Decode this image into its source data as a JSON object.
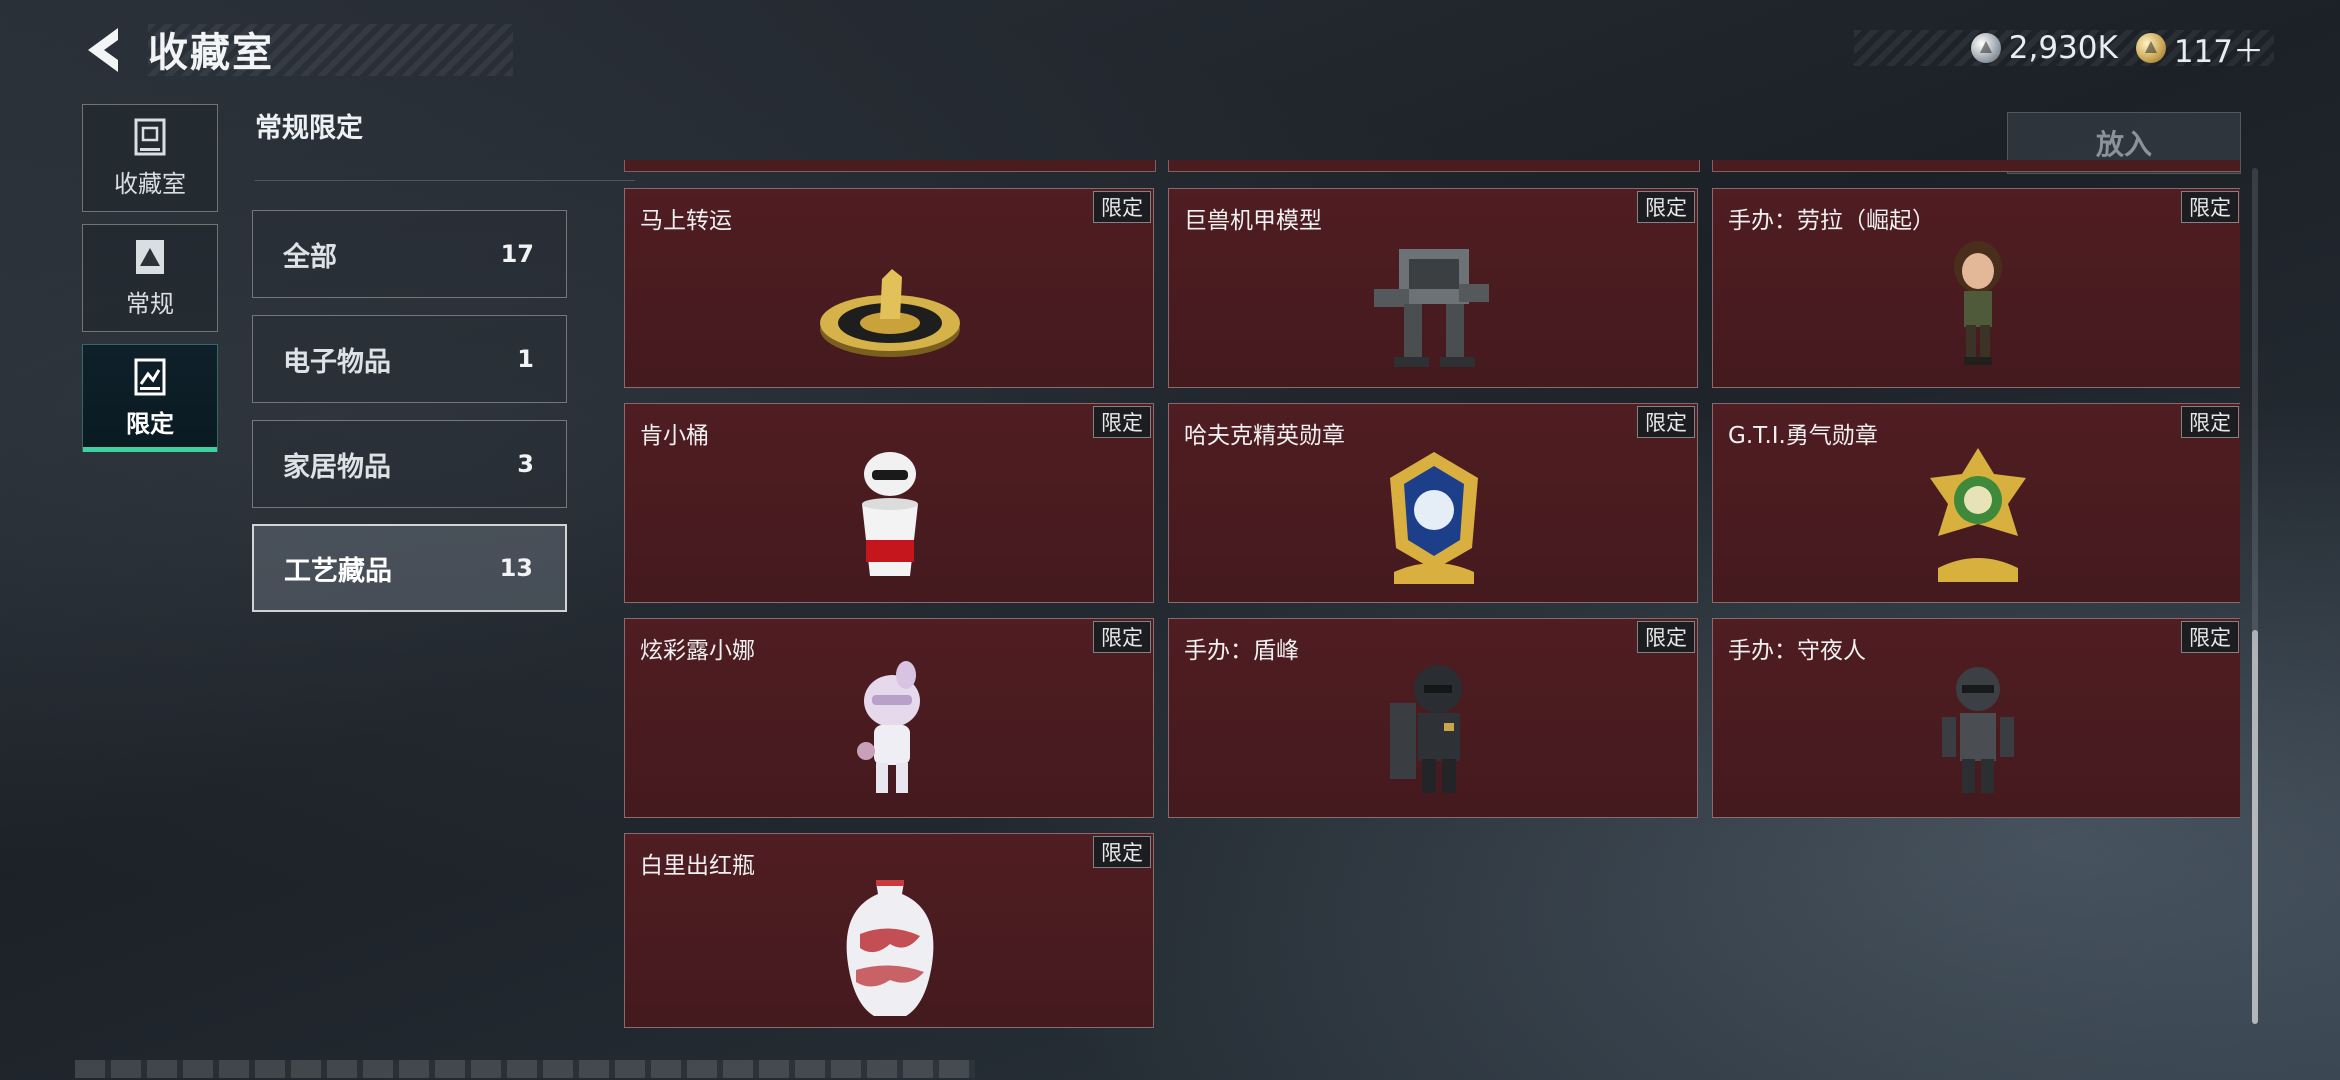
{
  "header": {
    "title": "收藏室"
  },
  "currency": [
    {
      "icon": "silver-coin-icon",
      "value": "2,930K"
    },
    {
      "icon": "gold-coin-icon",
      "value": "117＋"
    }
  ],
  "nav": [
    {
      "label": "收藏室",
      "icon": "vault-icon"
    },
    {
      "label": "常规",
      "icon": "regular-card-icon"
    },
    {
      "label": "限定",
      "icon": "limited-card-icon",
      "active": true
    }
  ],
  "section": {
    "title": "常规限定"
  },
  "categories": [
    {
      "name": "全部",
      "count": "17"
    },
    {
      "name": "电子物品",
      "count": "1"
    },
    {
      "name": "家居物品",
      "count": "3"
    },
    {
      "name": "工艺藏品",
      "count": "13",
      "active": true
    }
  ],
  "put_button": "放入",
  "tag_label": "限定",
  "items": [
    {
      "name": "马上转运",
      "icon": "horse-roulette-icon"
    },
    {
      "name": "巨兽机甲模型",
      "icon": "mech-model-icon"
    },
    {
      "name": "手办：劳拉（崛起）",
      "icon": "lara-figure-icon"
    },
    {
      "name": "肯小桶",
      "icon": "bucket-figure-icon"
    },
    {
      "name": "哈夫克精英勋章",
      "icon": "elite-medal-icon"
    },
    {
      "name": "G.T.I.勇气勋章",
      "icon": "courage-medal-icon"
    },
    {
      "name": "炫彩露小娜",
      "icon": "doll-figure-icon"
    },
    {
      "name": "手办：盾峰",
      "icon": "shield-soldier-figure-icon"
    },
    {
      "name": "手办：守夜人",
      "icon": "night-watch-figure-icon"
    },
    {
      "name": "白里出红瓶",
      "icon": "porcelain-vase-icon"
    }
  ],
  "colors": {
    "accent": "#3fd2a0",
    "card_bg": "#4a1c20"
  }
}
